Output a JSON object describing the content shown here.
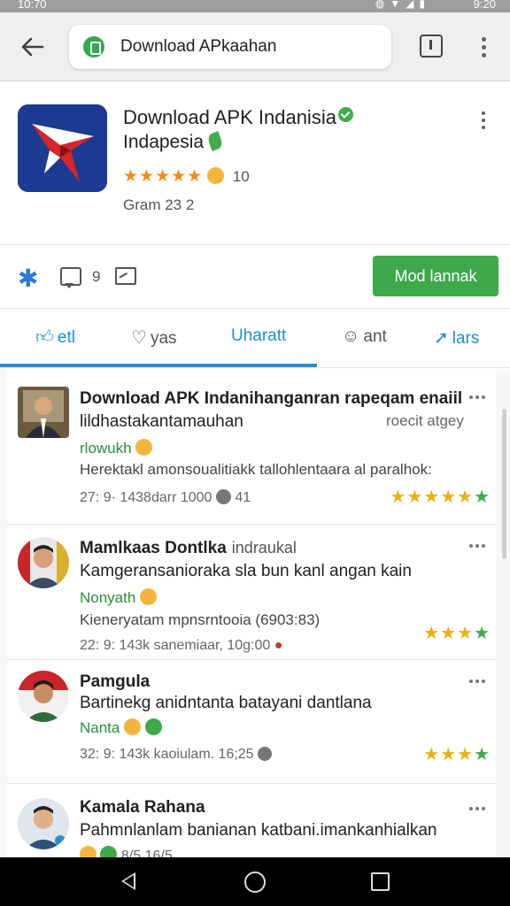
{
  "status_bar": {
    "time": "10:70",
    "clock": "9:20"
  },
  "browser": {
    "url_text": "Download APkaahan"
  },
  "app": {
    "title": "Download APK Indanisia",
    "subtitle": "Indapesia",
    "stars": "★★★★★",
    "rating_count": "10",
    "rating_value": 4.5,
    "installs": "Gram 23 2",
    "comment_count": "9",
    "install_label": "Mod lannak"
  },
  "tabs": [
    {
      "label": "etl",
      "icon": "thumbs-up-icon"
    },
    {
      "label": "yas",
      "icon": "heart-icon"
    },
    {
      "label": "Uharatt",
      "icon": ""
    },
    {
      "label": "ant",
      "icon": "smiley-icon"
    },
    {
      "label": "lars",
      "icon": "send-icon"
    }
  ],
  "reviews": [
    {
      "name": "Download APK Indanihanganran rapeqam enaiil",
      "tag": "",
      "line": "lildhastakantamauhan",
      "line_right": "roecit atgey",
      "green": "rlowukh",
      "body": "Herektakl amonsoualitiakk tallohlentaara al paralhok:",
      "meta": "27: 9· 1438darr 1000",
      "meta_extra": "41",
      "stars_yellow": "★★★★★",
      "stars_green": "★",
      "rating": 5
    },
    {
      "name": "Mamlkaas Dontlka",
      "tag": "indraukal",
      "line": "Kamgeransanioraka sla bun kanl angan kain",
      "line_right": "",
      "green": "Nonyath",
      "body": "Kieneryatam mpnsrntooia (6903:83)",
      "meta": "22: 9: 143k sanemiaar, 10g:00",
      "meta_extra": "",
      "stars_yellow": "★★★",
      "stars_green": "★",
      "rating": 4
    },
    {
      "name": "Pamgula",
      "tag": "",
      "line": "Bartinekg anidntanta batayani dantlana",
      "line_right": "",
      "green": "Nanta",
      "body": "",
      "meta": "32: 9: 143k kaoiulam. 16;25",
      "meta_extra": "",
      "stars_yellow": "★★★",
      "stars_green": "★",
      "rating": 4
    },
    {
      "name": "Kamala Rahana",
      "tag": "",
      "line": "Pahmnlanlam banianan katbani.imankanhialkan",
      "line_right": "",
      "green": "",
      "body": "",
      "meta": "8/5 16/5",
      "meta_extra": "",
      "stars_yellow": "",
      "stars_green": "",
      "rating": null
    }
  ]
}
